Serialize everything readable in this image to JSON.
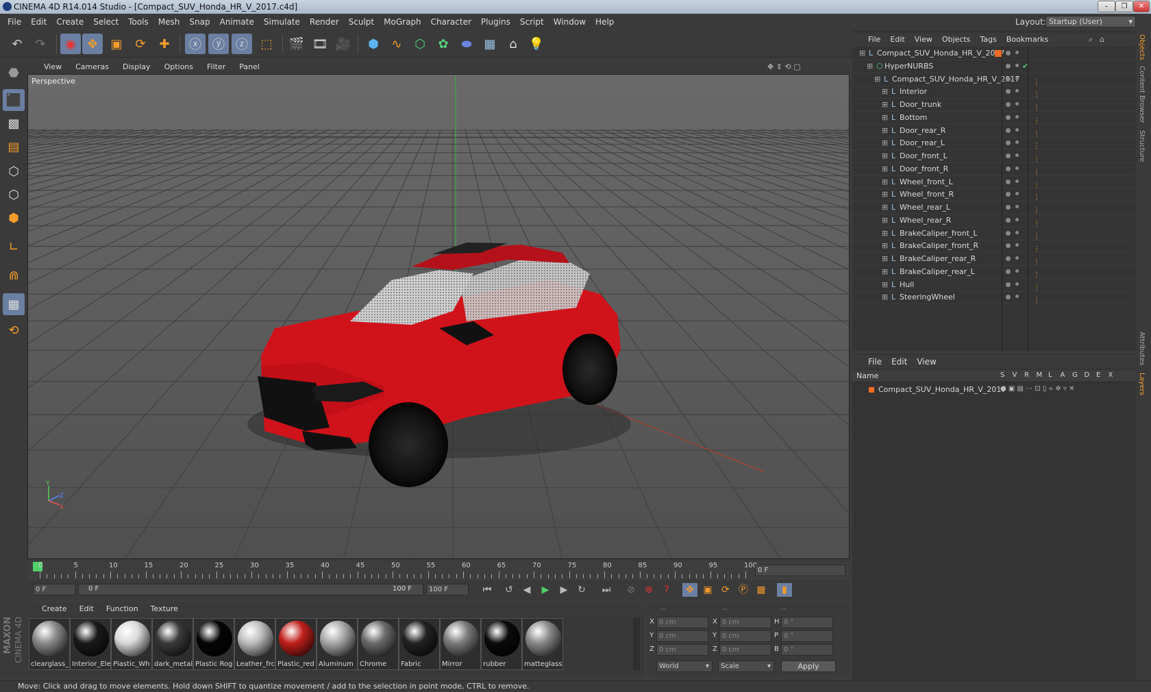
{
  "window": {
    "title": "CINEMA 4D R14.014 Studio - [Compact_SUV_Honda_HR_V_2017.c4d]"
  },
  "menu": [
    "File",
    "Edit",
    "Create",
    "Select",
    "Tools",
    "Mesh",
    "Snap",
    "Animate",
    "Simulate",
    "Render",
    "Sculpt",
    "MoGraph",
    "Character",
    "Plugins",
    "Script",
    "Window",
    "Help"
  ],
  "layout": {
    "label": "Layout:",
    "value": "Startup (User)"
  },
  "viewport": {
    "menu": [
      "View",
      "Cameras",
      "Display",
      "Options",
      "Filter",
      "Panel"
    ],
    "label": "Perspective",
    "axis_labels": {
      "y": "Y",
      "z": "Z",
      "x": "X"
    }
  },
  "timeline": {
    "ticks": [
      "0",
      "5",
      "10",
      "15",
      "20",
      "25",
      "30",
      "35",
      "40",
      "45",
      "50",
      "55",
      "60",
      "65",
      "70",
      "75",
      "80",
      "85",
      "90",
      "95",
      "100"
    ],
    "current_frame": "0 F"
  },
  "transport": {
    "start": "0 F",
    "range_start": "0 F",
    "range_end": "100 F",
    "end": "100 F"
  },
  "materials": {
    "menu": [
      "Create",
      "Edit",
      "Function",
      "Texture"
    ],
    "items": [
      {
        "label": "clearglass_",
        "color": "#8a8a8a"
      },
      {
        "label": "Interior_Ele",
        "color": "#1a1a1a"
      },
      {
        "label": "Plastic_Wh",
        "color": "#d9d9d9"
      },
      {
        "label": "dark_metal",
        "color": "#3a3a3a"
      },
      {
        "label": "Plastic Rog",
        "color": "#050505"
      },
      {
        "label": "Leather_frc",
        "color": "#bdbdbd"
      },
      {
        "label": "Plastic_red",
        "color": "#c0201b"
      },
      {
        "label": "Aluminum",
        "color": "#a9a9a9"
      },
      {
        "label": "Chrome",
        "color": "#6b6b6b"
      },
      {
        "label": "Fabric",
        "color": "#222222"
      },
      {
        "label": "Mirror",
        "color": "#7c7c7c"
      },
      {
        "label": "rubber",
        "color": "#0a0a0a"
      },
      {
        "label": "matteglass",
        "color": "#8a8a8a"
      }
    ]
  },
  "coords": {
    "headers": [
      "--",
      "--",
      "--"
    ],
    "rows": [
      {
        "a": "X",
        "av": "0 cm",
        "b": "X",
        "bv": "0 cm",
        "c": "H",
        "cv": "0 °"
      },
      {
        "a": "Y",
        "av": "0 cm",
        "b": "Y",
        "bv": "0 cm",
        "c": "P",
        "cv": "0 °"
      },
      {
        "a": "Z",
        "av": "0 cm",
        "b": "Z",
        "bv": "0 cm",
        "c": "B",
        "cv": "0 °"
      }
    ],
    "world": "World",
    "scale": "Scale",
    "apply": "Apply"
  },
  "objects": {
    "menu": [
      "File",
      "Edit",
      "View",
      "Objects",
      "Tags",
      "Bookmarks"
    ],
    "tree": [
      {
        "name": "Compact_SUV_Honda_HR_V_2017",
        "level": 0
      },
      {
        "name": "HyperNURBS",
        "level": 1
      },
      {
        "name": "Compact_SUV_Honda_HR_V_2017",
        "level": 2
      },
      {
        "name": "Interior",
        "level": 3
      },
      {
        "name": "Door_trunk",
        "level": 3
      },
      {
        "name": "Bottom",
        "level": 3
      },
      {
        "name": "Door_rear_R",
        "level": 3
      },
      {
        "name": "Door_rear_L",
        "level": 3
      },
      {
        "name": "Door_front_L",
        "level": 3
      },
      {
        "name": "Door_front_R",
        "level": 3
      },
      {
        "name": "Wheel_front_L",
        "level": 3
      },
      {
        "name": "Wheel_front_R",
        "level": 3
      },
      {
        "name": "Wheel_rear_L",
        "level": 3
      },
      {
        "name": "Wheel_rear_R",
        "level": 3
      },
      {
        "name": "BrakeCaliper_front_L",
        "level": 3
      },
      {
        "name": "BrakeCaliper_front_R",
        "level": 3
      },
      {
        "name": "BrakeCaliper_rear_R",
        "level": 3
      },
      {
        "name": "BrakeCaliper_rear_L",
        "level": 3
      },
      {
        "name": "Hull",
        "level": 3
      },
      {
        "name": "SteeringWheel",
        "level": 3
      }
    ]
  },
  "layers": {
    "menu": [
      "File",
      "Edit",
      "View"
    ],
    "header": {
      "name": "Name",
      "cols": [
        "S",
        "V",
        "R",
        "M",
        "L",
        "A",
        "G",
        "D",
        "E",
        "X"
      ]
    },
    "rows": [
      {
        "name": "Compact_SUV_Honda_HR_V_2017"
      }
    ]
  },
  "side_tabs": [
    "Objects",
    "Content Browser",
    "Structure",
    "Attributes",
    "Layers"
  ],
  "logo": {
    "line1": "MAXON",
    "line2": "CINEMA 4D"
  },
  "status": "Move: Click and drag to move elements. Hold down SHIFT to quantize movement / add to the selection in point mode, CTRL to remove.",
  "colors": {
    "accent": "#6b7fa2",
    "car": "#d0131b",
    "orange": "#f49c2b"
  }
}
